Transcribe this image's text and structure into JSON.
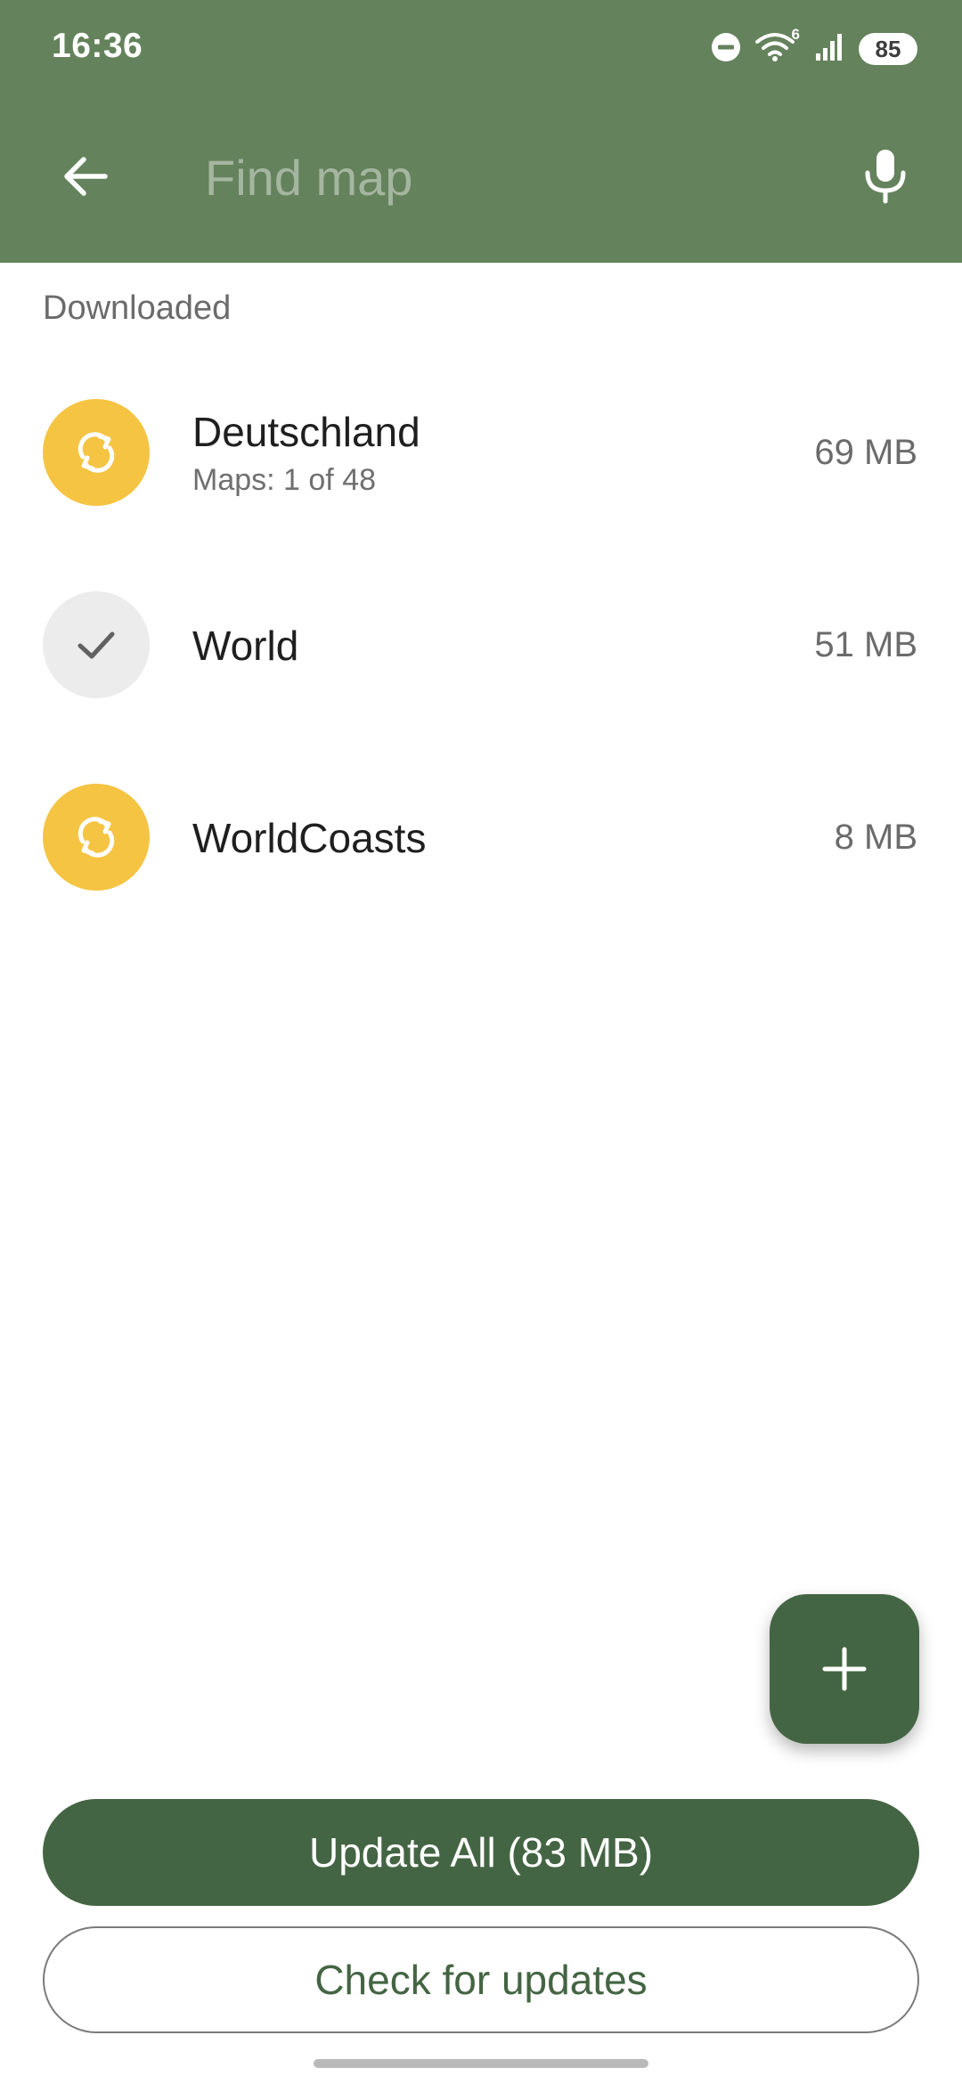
{
  "status_bar": {
    "time": "16:36",
    "wifi_badge": "6",
    "battery": "85"
  },
  "search": {
    "placeholder": "Find map",
    "value": ""
  },
  "section": {
    "header": "Downloaded"
  },
  "maps": [
    {
      "title": "Deutschland",
      "subtitle": "Maps: 1 of 48",
      "size": "69 MB",
      "status_icon": "refresh-icon",
      "status_color": "#f5c443"
    },
    {
      "title": "World",
      "subtitle": "",
      "size": "51 MB",
      "status_icon": "check-icon",
      "status_color": "#ececec"
    },
    {
      "title": "WorldCoasts",
      "subtitle": "",
      "size": "8 MB",
      "status_icon": "refresh-icon",
      "status_color": "#f5c443"
    }
  ],
  "actions": {
    "update_all": "Update All (83 MB)",
    "check_updates": "Check for updates"
  },
  "colors": {
    "app_bar": "#64825c",
    "primary": "#446543",
    "update_needed": "#f5c443",
    "up_to_date": "#ececec"
  }
}
